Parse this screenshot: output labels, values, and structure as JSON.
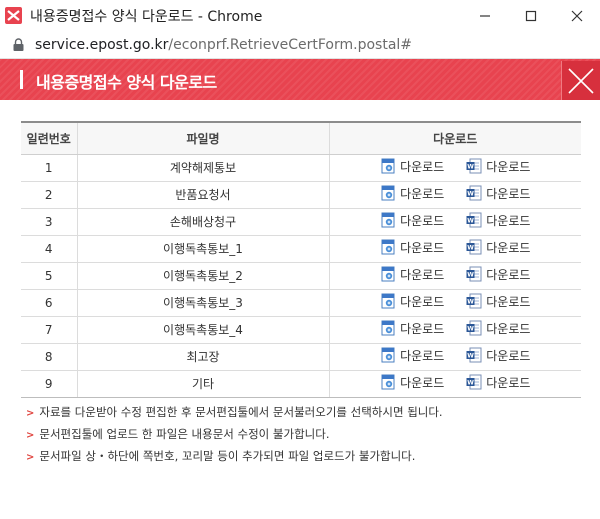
{
  "window": {
    "title": "내용증명접수 양식 다운로드 - Chrome",
    "url_domain": "service.epost.go.kr",
    "url_path": "/econprf.RetrieveCertForm.postal#"
  },
  "header": {
    "title": "내용증명접수 양식 다운로드"
  },
  "table": {
    "headers": [
      "일련번호",
      "파일명",
      "다운로드"
    ],
    "rows": [
      {
        "no": "1",
        "name": "계약해제통보",
        "hwp": "다운로드",
        "doc": "다운로드"
      },
      {
        "no": "2",
        "name": "반품요청서",
        "hwp": "다운로드",
        "doc": "다운로드"
      },
      {
        "no": "3",
        "name": "손해배상청구",
        "hwp": "다운로드",
        "doc": "다운로드"
      },
      {
        "no": "4",
        "name": "이행독촉통보_1",
        "hwp": "다운로드",
        "doc": "다운로드"
      },
      {
        "no": "5",
        "name": "이행독촉통보_2",
        "hwp": "다운로드",
        "doc": "다운로드"
      },
      {
        "no": "6",
        "name": "이행독촉통보_3",
        "hwp": "다운로드",
        "doc": "다운로드"
      },
      {
        "no": "7",
        "name": "이행독촉통보_4",
        "hwp": "다운로드",
        "doc": "다운로드"
      },
      {
        "no": "8",
        "name": "최고장",
        "hwp": "다운로드",
        "doc": "다운로드"
      },
      {
        "no": "9",
        "name": "기타",
        "hwp": "다운로드",
        "doc": "다운로드"
      }
    ]
  },
  "notes": [
    "자료를 다운받아 수정 편집한 후 문서편집툴에서 문서불러오기를 선택하시면 됩니다.",
    "문서편집툴에 업로드 한 파일은 내용문서 수정이 불가합니다.",
    "문서파일 상・하단에 쪽번호, 꼬리말 등이 추가되면 파일 업로드가 불가합니다."
  ],
  "colors": {
    "header_red": "#e8434f",
    "close_red": "#d7303d",
    "note_arrow": "#e0453f"
  },
  "icons": {
    "app": "mail-x-icon",
    "lock": "lock-icon",
    "hwp": "hwp-file-icon",
    "doc": "word-file-icon",
    "close": "close-icon"
  }
}
